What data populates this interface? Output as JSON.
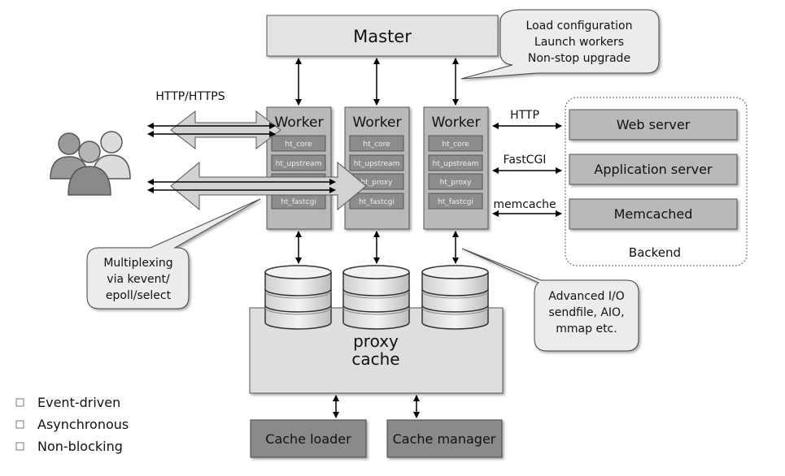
{
  "master": {
    "label": "Master"
  },
  "master_note": [
    "Load configuration",
    "Launch workers",
    "Non-stop upgrade"
  ],
  "client_protocol": "HTTP/HTTPS",
  "workers": [
    {
      "label": "Worker",
      "modules": [
        "ht_core",
        "ht_upstream",
        "",
        "ht_fastcgi"
      ]
    },
    {
      "label": "Worker",
      "modules": [
        "ht_core",
        "ht_upstream",
        "ht_proxy",
        "ht_fastcgi"
      ]
    },
    {
      "label": "Worker",
      "modules": [
        "ht_core",
        "ht_upstream",
        "ht_proxy",
        "ht_fastcgi"
      ]
    }
  ],
  "backend": {
    "label": "Backend",
    "protocols": [
      "HTTP",
      "FastCGI",
      "memcache"
    ],
    "servers": [
      "Web server",
      "Application server",
      "Memcached"
    ]
  },
  "multiplex_note": [
    "Multiplexing",
    "via kevent/",
    "epoll/select"
  ],
  "io_note": [
    "Advanced I/O",
    "sendfile, AIO,",
    "mmap etc."
  ],
  "proxy_cache": [
    "proxy",
    "cache"
  ],
  "cache_loader": "Cache loader",
  "cache_manager": "Cache manager",
  "features": [
    "Event-driven",
    "Asynchronous",
    "Non-blocking"
  ],
  "colors": {
    "light_box": "#e3e3e3",
    "worker": "#b9b9b9",
    "module": "#8c8c8c",
    "dark_box": "#8a8a8a"
  }
}
